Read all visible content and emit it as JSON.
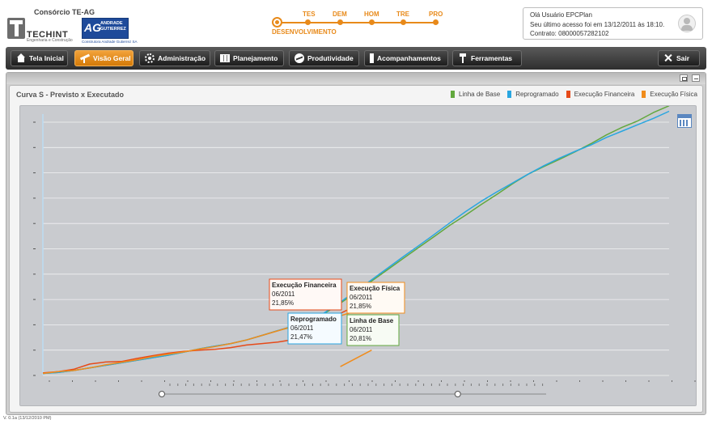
{
  "header": {
    "company": "Consórcio TE-AG",
    "logo1_name": "TECHINT",
    "logo1_sub": "Engenharia e Construção",
    "logo2_mark": "AG",
    "logo2_name": "ANDRADE GUTIERREZ",
    "logo2_sub": "Construtora Andrade Gutierrez SA"
  },
  "stepper": {
    "current": "DESENVOLVIMENTO",
    "steps": [
      "TES",
      "DEM",
      "HOM",
      "TRE",
      "PRO"
    ]
  },
  "user": {
    "greeting": "Olá Usuário EPCPlan",
    "last_access": "Seu último acesso foi em  13/12/2011 às 18:10.",
    "contract": "Contrato: 08000057282102"
  },
  "nav": {
    "home": "Tela Inicial",
    "overview": "Visão Geral",
    "admin": "Administração",
    "planning": "Planejamento",
    "productivity": "Produtividade",
    "tracking": "Acompanhamentos",
    "tools": "Ferramentas",
    "exit": "Sair"
  },
  "chart_data": {
    "type": "line",
    "title": "Curva S - Previsto x Executado",
    "xlabel": "",
    "ylabel": "",
    "ylim": [
      0,
      100
    ],
    "grid": true,
    "legend_position": "top-right",
    "series": [
      {
        "name": "Linha de Base",
        "color": "#62a83e",
        "x": [
          0,
          3,
          6,
          9,
          12,
          15,
          18,
          21,
          24,
          27,
          30,
          33,
          36,
          39,
          42,
          45,
          48,
          51,
          54,
          57,
          60,
          63,
          66,
          69,
          72,
          75,
          78,
          81,
          84,
          87,
          90,
          93,
          96,
          99,
          102,
          105,
          108,
          111,
          114,
          117,
          120
        ],
        "y": [
          0.8,
          1.2,
          2.0,
          3.0,
          4.0,
          5.0,
          6.0,
          7.0,
          8.0,
          9.2,
          10.5,
          11.6,
          12.6,
          14.0,
          15.8,
          17.7,
          19.3,
          20.81,
          24.5,
          28.5,
          32.8,
          37.3,
          41.7,
          46.1,
          50.5,
          54.9,
          59.3,
          63.3,
          67.5,
          71.5,
          75.7,
          79.5,
          82.5,
          85.3,
          88.3,
          91.5,
          95.0,
          98.0,
          100.5,
          103.8,
          106.5
        ]
      },
      {
        "name": "Reprogramado",
        "color": "#29a6e0",
        "x": [
          0,
          3,
          6,
          9,
          12,
          15,
          18,
          21,
          24,
          27,
          30,
          33,
          36,
          39,
          42,
          45,
          48,
          51,
          54,
          57,
          60,
          63,
          66,
          69,
          72,
          75,
          78,
          81,
          84,
          87,
          90,
          93,
          96,
          99,
          102,
          105,
          108,
          111,
          114,
          117,
          120
        ],
        "y": [
          0.8,
          1.2,
          2.0,
          3.0,
          4.0,
          5.0,
          6.0,
          7.0,
          8.0,
          9.2,
          10.5,
          11.6,
          12.6,
          14.0,
          15.8,
          17.7,
          19.6,
          21.47,
          24.8,
          29.0,
          33.3,
          37.8,
          42.3,
          46.8,
          51.2,
          55.7,
          60.3,
          64.7,
          68.8,
          72.5,
          76.0,
          79.5,
          82.8,
          85.8,
          88.5,
          91.0,
          94.0,
          96.5,
          99.0,
          101.5,
          104.3
        ]
      },
      {
        "name": "Execução Financeira",
        "color": "#e64a19",
        "x": [
          0,
          3,
          6,
          9,
          12,
          15,
          18,
          21,
          24,
          27,
          30,
          33,
          36,
          39,
          42,
          45,
          48,
          51,
          54,
          57,
          60
        ],
        "y": [
          1.0,
          1.5,
          2.5,
          4.5,
          5.3,
          5.5,
          6.7,
          7.8,
          8.8,
          9.5,
          10.0,
          10.3,
          11.0,
          12.0,
          12.6,
          13.2,
          14.2,
          16.0,
          21.85,
          24.5,
          27.5
        ]
      },
      {
        "name": "Execução Física",
        "color": "#f08c1c",
        "x": [
          0,
          3,
          6,
          9,
          12,
          15,
          18,
          21,
          24,
          27,
          30,
          33,
          36,
          39,
          42,
          45,
          48,
          51,
          54,
          57,
          60
        ],
        "y": [
          0.8,
          1.5,
          2.0,
          3.0,
          4.2,
          5.2,
          6.2,
          7.4,
          8.4,
          9.3,
          10.4,
          11.4,
          12.6,
          14.0,
          15.8,
          17.6,
          19.5,
          21.0,
          21.85,
          23.5,
          25.5
        ]
      }
    ],
    "extra_segment": {
      "series": "Execução Física",
      "x": [
        57,
        63
      ],
      "y": [
        3.5,
        10.0
      ]
    },
    "tooltips": [
      {
        "series": "Execução Financeira",
        "date": "06/2011",
        "value": "21,85%"
      },
      {
        "series": "Execução Física",
        "date": "06/2011",
        "value": "21,85%"
      },
      {
        "series": "Reprogramado",
        "date": "06/2011",
        "value": "21,47%"
      },
      {
        "series": "Linha de Base",
        "date": "06/2011",
        "value": "20,81%"
      }
    ],
    "range_slider": {
      "start_fraction": 0.0,
      "end_fraction": 0.77
    }
  },
  "footer": {
    "version": "V. 0.1a (13/12/2010 PM)"
  }
}
